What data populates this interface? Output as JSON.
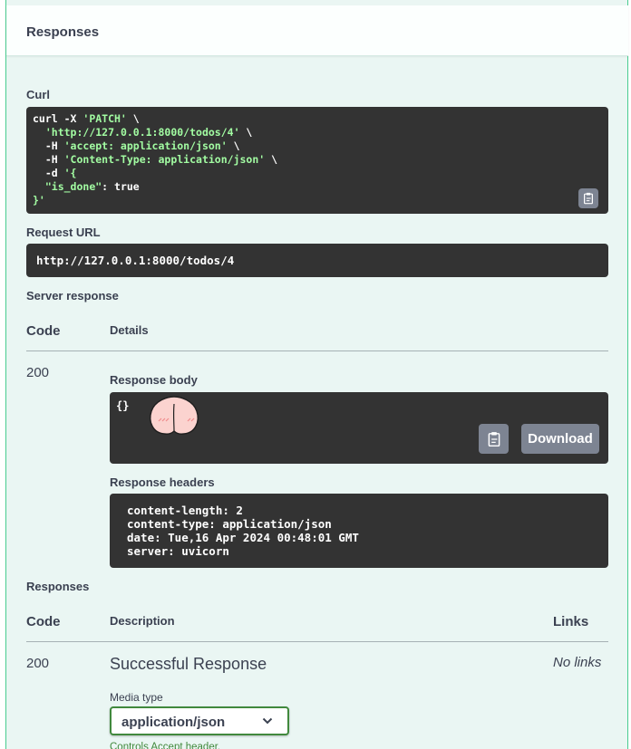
{
  "responses_section": {
    "title": "Responses"
  },
  "curl": {
    "label": "Curl",
    "lines": [
      {
        "pre": "curl -X ",
        "str": "'PATCH'",
        "post": " \\"
      },
      {
        "pre": "  ",
        "str": "'http://127.0.0.1:8000/todos/4'",
        "post": " \\"
      },
      {
        "pre": "  -H ",
        "str": "'accept: application/json'",
        "post": " \\"
      },
      {
        "pre": "  -H ",
        "str": "'Content-Type: application/json'",
        "post": " \\"
      },
      {
        "pre": "  -d ",
        "str": "'{",
        "post": ""
      },
      {
        "pre": "  ",
        "str": "\"is_done\"",
        "post": ": true"
      },
      {
        "pre": "",
        "str": "}'",
        "post": ""
      }
    ]
  },
  "request_url": {
    "label": "Request URL",
    "value": "http://127.0.0.1:8000/todos/4"
  },
  "server_response": {
    "label": "Server response",
    "col_code": "Code",
    "col_details": "Details",
    "code": "200",
    "body_label": "Response body",
    "body": "{}",
    "download_label": "Download",
    "headers_label": "Response headers",
    "headers": [
      "content-length: 2",
      "content-type: application/json",
      "date: Tue,16 Apr 2024 00:48:01 GMT",
      "server: uvicorn"
    ]
  },
  "responses": {
    "label": "Responses",
    "col_code": "Code",
    "col_description": "Description",
    "col_links": "Links",
    "code": "200",
    "description": "Successful Response",
    "links": "No links",
    "media_type_label": "Media type",
    "media_type_value": "application/json",
    "controls_text": "Controls Accept header."
  },
  "colors": {
    "accent": "#49cc90",
    "panel_bg": "#eaf6f3",
    "code_bg": "#333333",
    "button_gray": "#7d8492",
    "select_border": "#41893d"
  }
}
